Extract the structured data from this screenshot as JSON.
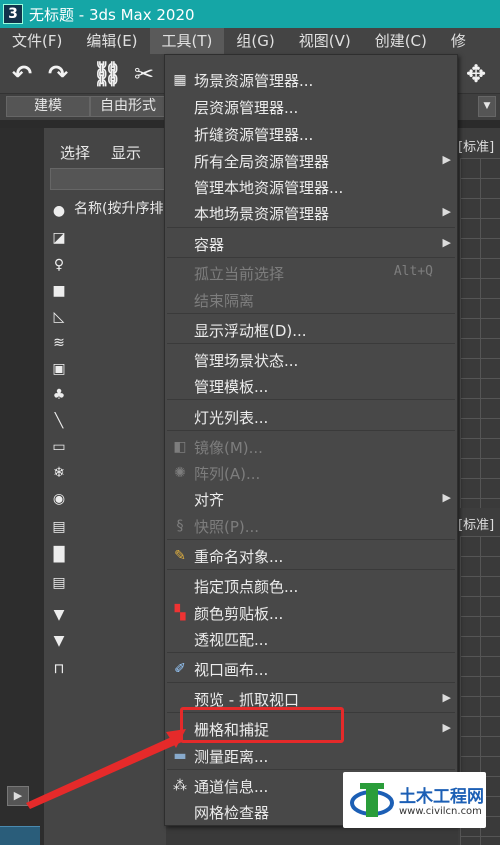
{
  "window": {
    "title": "无标题 - 3ds Max 2020",
    "app_icon": "3"
  },
  "menubar": [
    {
      "label": "文件(F)"
    },
    {
      "label": "编辑(E)"
    },
    {
      "label": "工具(T)"
    },
    {
      "label": "组(G)"
    },
    {
      "label": "视图(V)"
    },
    {
      "label": "创建(C)"
    },
    {
      "label": "修"
    }
  ],
  "ribbon": {
    "tab1": "建模",
    "tab2": "自由形式"
  },
  "explorer": {
    "tab_select": "选择",
    "tab_display": "显示",
    "column_header": "名称(按升序排"
  },
  "viewport": {
    "label_top": "[标准]",
    "label_mid": "[标准]"
  },
  "tools_menu": {
    "items": [
      {
        "label": "场景资源管理器...",
        "icon": "table-icon"
      },
      {
        "label": "层资源管理器..."
      },
      {
        "label": "折缝资源管理器..."
      },
      {
        "label": "所有全局资源管理器",
        "submenu": true
      },
      {
        "label": "管理本地资源管理器..."
      },
      {
        "label": "本地场景资源管理器",
        "submenu": true
      },
      {
        "label": "容器",
        "submenu": true
      },
      {
        "label": "孤立当前选择",
        "shortcut": "Alt+Q",
        "disabled": true
      },
      {
        "label": "结束隔离",
        "disabled": true
      },
      {
        "label": "显示浮动框(D)..."
      },
      {
        "label": "管理场景状态..."
      },
      {
        "label": "管理模板..."
      },
      {
        "label": "灯光列表..."
      },
      {
        "label": "镜像(M)...",
        "disabled": true,
        "icon": "mirror-icon"
      },
      {
        "label": "阵列(A)...",
        "disabled": true,
        "icon": "array-icon"
      },
      {
        "label": "对齐",
        "submenu": true
      },
      {
        "label": "快照(P)...",
        "disabled": true,
        "icon": "snapshot-icon"
      },
      {
        "label": "重命名对象...",
        "icon": "rename-icon"
      },
      {
        "label": "指定顶点颜色..."
      },
      {
        "label": "颜色剪贴板...",
        "icon": "color-clipboard-icon"
      },
      {
        "label": "透视匹配..."
      },
      {
        "label": "视口画布...",
        "icon": "brush-icon"
      },
      {
        "label": "预览 - 抓取视口",
        "submenu": true
      },
      {
        "label": "栅格和捕捉",
        "submenu": true
      },
      {
        "label": "测量距离...",
        "icon": "ruler-icon"
      },
      {
        "label": "通道信息...",
        "icon": "channel-icon"
      },
      {
        "label": "网格检查器"
      }
    ]
  },
  "watermark": {
    "line1": "土木工程网",
    "line2": "www.civilcn.com"
  },
  "colors": {
    "titlebar": "#15a6a6",
    "highlight": "#e52a2a",
    "menu_bg": "#484848"
  }
}
